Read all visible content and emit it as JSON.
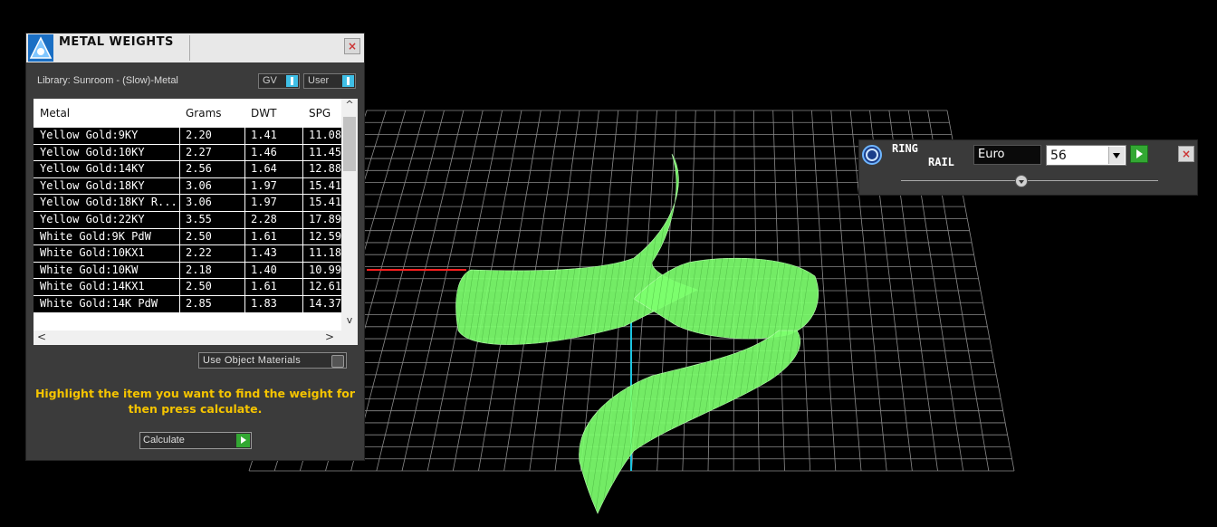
{
  "viewport": {
    "colors": {
      "background": "#000000",
      "grid": "#8a8a8a",
      "model": "#7dff6e",
      "x_axis": "#ff2020",
      "z_axis": "#1cc4e0"
    }
  },
  "metal_weights": {
    "title": "METAL WEIGHTS",
    "close_label": "×",
    "library_label": "Library: Sunroom - (Slow)-Metal",
    "toggles": [
      {
        "label": "GV",
        "state": "on"
      },
      {
        "label": "User",
        "state": "on"
      }
    ],
    "table": {
      "columns": [
        "Metal",
        "Grams",
        "DWT",
        "SPG"
      ],
      "rows": [
        [
          "Yellow Gold:9KY",
          "2.20",
          "1.41",
          "11.08"
        ],
        [
          "Yellow Gold:10KY",
          "2.27",
          "1.46",
          "11.45"
        ],
        [
          "Yellow Gold:14KY",
          "2.56",
          "1.64",
          "12.88"
        ],
        [
          "Yellow Gold:18KY",
          "3.06",
          "1.97",
          "15.41"
        ],
        [
          "Yellow Gold:18KY R...",
          "3.06",
          "1.97",
          "15.41"
        ],
        [
          "Yellow Gold:22KY",
          "3.55",
          "2.28",
          "17.89"
        ],
        [
          "White Gold:9K PdW",
          "2.50",
          "1.61",
          "12.59"
        ],
        [
          "White Gold:10KX1",
          "2.22",
          "1.43",
          "11.18"
        ],
        [
          "White Gold:10KW",
          "2.18",
          "1.40",
          "10.99"
        ],
        [
          "White Gold:14KX1",
          "2.50",
          "1.61",
          "12.61"
        ],
        [
          "White Gold:14K PdW",
          "2.85",
          "1.83",
          "14.37"
        ]
      ],
      "scroll_up": "^",
      "scroll_down": "v",
      "scroll_left": "<",
      "scroll_right": ">"
    },
    "use_object_materials_label": "Use Object Materials",
    "instruction": "Highlight the item you want to find the weight for then press calculate.",
    "calculate_label": "Calculate",
    "colors": {
      "instruction": "#f5c400",
      "toggle_on": "#3fbfe6",
      "go": "#33a833"
    }
  },
  "ring_rail": {
    "title_line1": "RING",
    "title_line2": "RAIL",
    "sizing_system": "Euro",
    "size_value": "56",
    "close_label": "×",
    "slider_value": 0.47
  }
}
